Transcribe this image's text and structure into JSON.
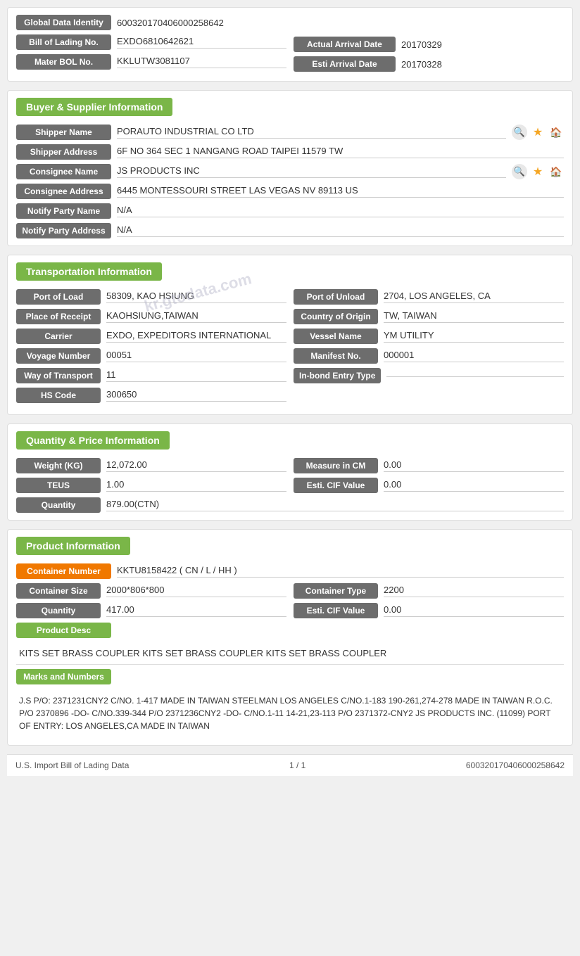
{
  "identity": {
    "global_data_label": "Global Data Identity",
    "global_data_value": "600320170406000258642",
    "bill_label": "Bill of Lading No.",
    "bill_value": "EXDO6810642621",
    "actual_arrival_label": "Actual Arrival Date",
    "actual_arrival_value": "20170329",
    "mater_bol_label": "Mater BOL No.",
    "mater_bol_value": "KKLUTW3081107",
    "esti_arrival_label": "Esti Arrival Date",
    "esti_arrival_value": "20170328"
  },
  "buyer_supplier": {
    "section_title": "Buyer & Supplier Information",
    "shipper_name_label": "Shipper Name",
    "shipper_name_value": "PORAUTO INDUSTRIAL CO LTD",
    "shipper_address_label": "Shipper Address",
    "shipper_address_value": "6F NO 364 SEC 1 NANGANG ROAD TAIPEI 11579 TW",
    "consignee_name_label": "Consignee Name",
    "consignee_name_value": "JS PRODUCTS INC",
    "consignee_address_label": "Consignee Address",
    "consignee_address_value": "6445 MONTESSOURI STREET LAS VEGAS NV 89113 US",
    "notify_party_name_label": "Notify Party Name",
    "notify_party_name_value": "N/A",
    "notify_party_address_label": "Notify Party Address",
    "notify_party_address_value": "N/A"
  },
  "transportation": {
    "section_title": "Transportation Information",
    "port_load_label": "Port of Load",
    "port_load_value": "58309, KAO HSIUNG",
    "port_unload_label": "Port of Unload",
    "port_unload_value": "2704, LOS ANGELES, CA",
    "place_receipt_label": "Place of Receipt",
    "place_receipt_value": "KAOHSIUNG,TAIWAN",
    "country_origin_label": "Country of Origin",
    "country_origin_value": "TW, TAIWAN",
    "carrier_label": "Carrier",
    "carrier_value": "EXDO, EXPEDITORS INTERNATIONAL",
    "vessel_name_label": "Vessel Name",
    "vessel_name_value": "YM UTILITY",
    "voyage_number_label": "Voyage Number",
    "voyage_number_value": "00051",
    "manifest_no_label": "Manifest No.",
    "manifest_no_value": "000001",
    "way_transport_label": "Way of Transport",
    "way_transport_value": "11",
    "inbond_entry_label": "In-bond Entry Type",
    "inbond_entry_value": "",
    "hs_code_label": "HS Code",
    "hs_code_value": "300650",
    "watermark": "kr.gtodata.com"
  },
  "quantity_price": {
    "section_title": "Quantity & Price Information",
    "weight_label": "Weight (KG)",
    "weight_value": "12,072.00",
    "measure_label": "Measure in CM",
    "measure_value": "0.00",
    "teus_label": "TEUS",
    "teus_value": "1.00",
    "esti_cif_label": "Esti. CIF Value",
    "esti_cif_value": "0.00",
    "quantity_label": "Quantity",
    "quantity_value": "879.00(CTN)"
  },
  "product_info": {
    "section_title": "Product Information",
    "container_number_label": "Container Number",
    "container_number_value": "KKTU8158422 ( CN / L / HH )",
    "container_size_label": "Container Size",
    "container_size_value": "2000*806*800",
    "container_type_label": "Container Type",
    "container_type_value": "2200",
    "quantity_label": "Quantity",
    "quantity_value": "417.00",
    "esti_cif_label": "Esti. CIF Value",
    "esti_cif_value": "0.00",
    "product_desc_label": "Product Desc",
    "product_desc_text": "KITS SET BRASS COUPLER KITS SET BRASS COUPLER KITS SET BRASS COUPLER",
    "marks_numbers_label": "Marks and Numbers",
    "marks_numbers_text": "J.S P/O: 2371231CNY2 C/NO. 1-417 MADE IN TAIWAN STEELMAN LOS ANGELES C/NO.1-183 190-261,274-278 MADE IN TAIWAN R.O.C. P/O 2370896 -DO- C/NO.339-344 P/O 2371236CNY2 -DO- C/NO.1-11 14-21,23-113 P/O 2371372-CNY2 JS PRODUCTS INC. (11099) PORT OF ENTRY: LOS ANGELES,CA MADE IN TAIWAN"
  },
  "footer": {
    "left_text": "U.S. Import Bill of Lading Data",
    "center_text": "1 / 1",
    "right_text": "600320170406000258642"
  }
}
